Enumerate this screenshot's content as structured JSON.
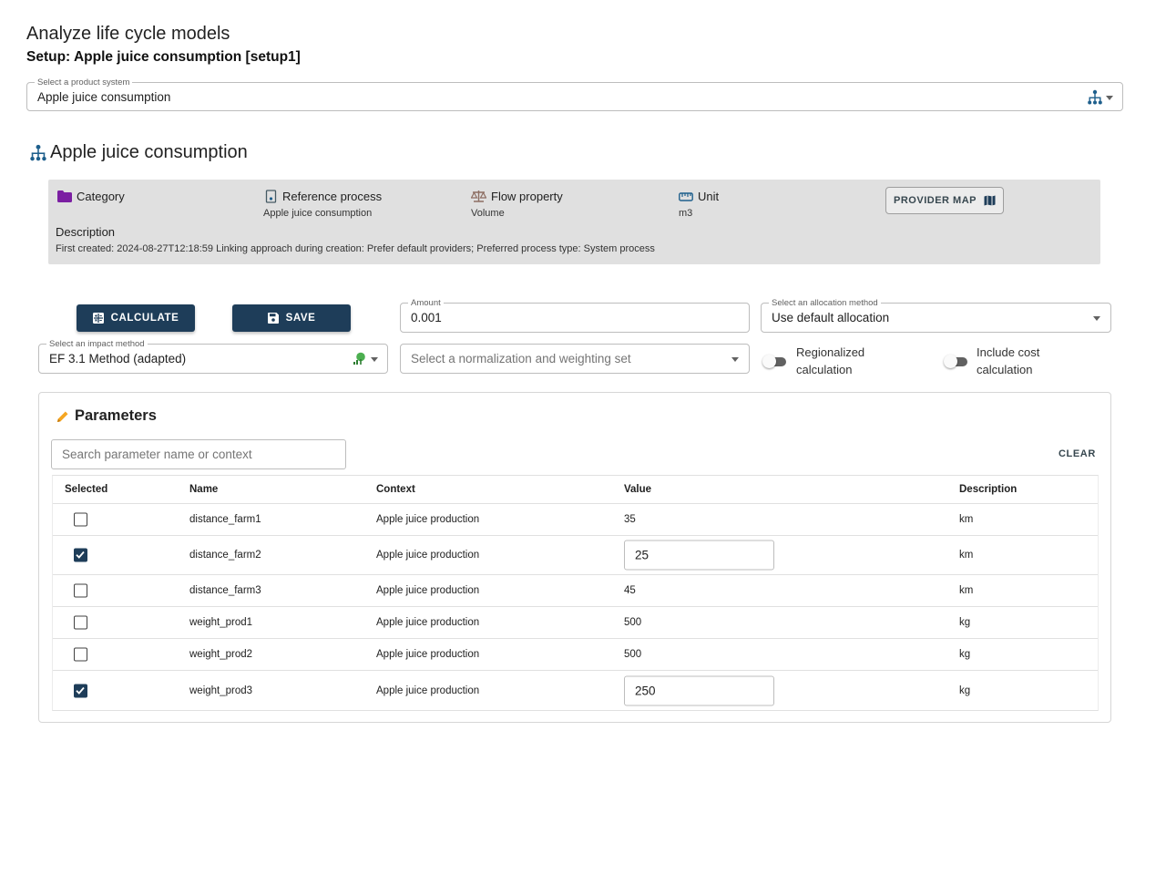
{
  "page": {
    "title": "Analyze life cycle models",
    "subtitle": "Setup: Apple juice consumption [setup1]"
  },
  "product_system_select": {
    "label": "Select a product system",
    "value": "Apple juice consumption",
    "icon": "product-system-icon"
  },
  "product_system": {
    "heading": "Apple juice consumption",
    "icon": "product-system-icon"
  },
  "info": {
    "category_label": "Category",
    "category_icon": "folder-icon",
    "category_color": "#7b1fa2",
    "reference_process_label": "Reference process",
    "reference_process_value": "Apple juice consumption",
    "flow_property_label": "Flow property",
    "flow_property_value": "Volume",
    "unit_label": "Unit",
    "unit_value": "m3",
    "provider_map_button": "PROVIDER MAP",
    "description_label": "Description",
    "description_text": "First created: 2024-08-27T12:18:59 Linking approach during creation: Prefer default providers; Preferred process type: System process"
  },
  "controls": {
    "calculate_button": "CALCULATE",
    "save_button": "SAVE",
    "amount_label": "Amount",
    "amount_value": "0.001",
    "allocation_label": "Select an allocation method",
    "allocation_value": "Use default allocation",
    "impact_method_label": "Select an impact method",
    "impact_method_value": "EF 3.1 Method (adapted)",
    "normalization_placeholder": "Select a normalization and weighting set",
    "regionalized_label_line1": "Regionalized",
    "regionalized_label_line2": "calculation",
    "regionalized_on": false,
    "cost_label_line1": "Include cost",
    "cost_label_line2": "calculation",
    "cost_on": false,
    "button_color": "#1e3d59"
  },
  "parameters": {
    "title": "Parameters",
    "search_placeholder": "Search parameter name or context",
    "clear_label": "CLEAR",
    "columns": [
      "Selected",
      "Name",
      "Context",
      "Value",
      "Description"
    ],
    "rows": [
      {
        "selected": false,
        "name": "distance_farm1",
        "context": "Apple juice production",
        "value": "35",
        "description": "km"
      },
      {
        "selected": true,
        "name": "distance_farm2",
        "context": "Apple juice production",
        "value": "25",
        "description": "km"
      },
      {
        "selected": false,
        "name": "distance_farm3",
        "context": "Apple juice production",
        "value": "45",
        "description": "km"
      },
      {
        "selected": false,
        "name": "weight_prod1",
        "context": "Apple juice production",
        "value": "500",
        "description": "kg"
      },
      {
        "selected": false,
        "name": "weight_prod2",
        "context": "Apple juice production",
        "value": "500",
        "description": "kg"
      },
      {
        "selected": true,
        "name": "weight_prod3",
        "context": "Apple juice production",
        "value": "250",
        "description": "kg"
      }
    ]
  }
}
